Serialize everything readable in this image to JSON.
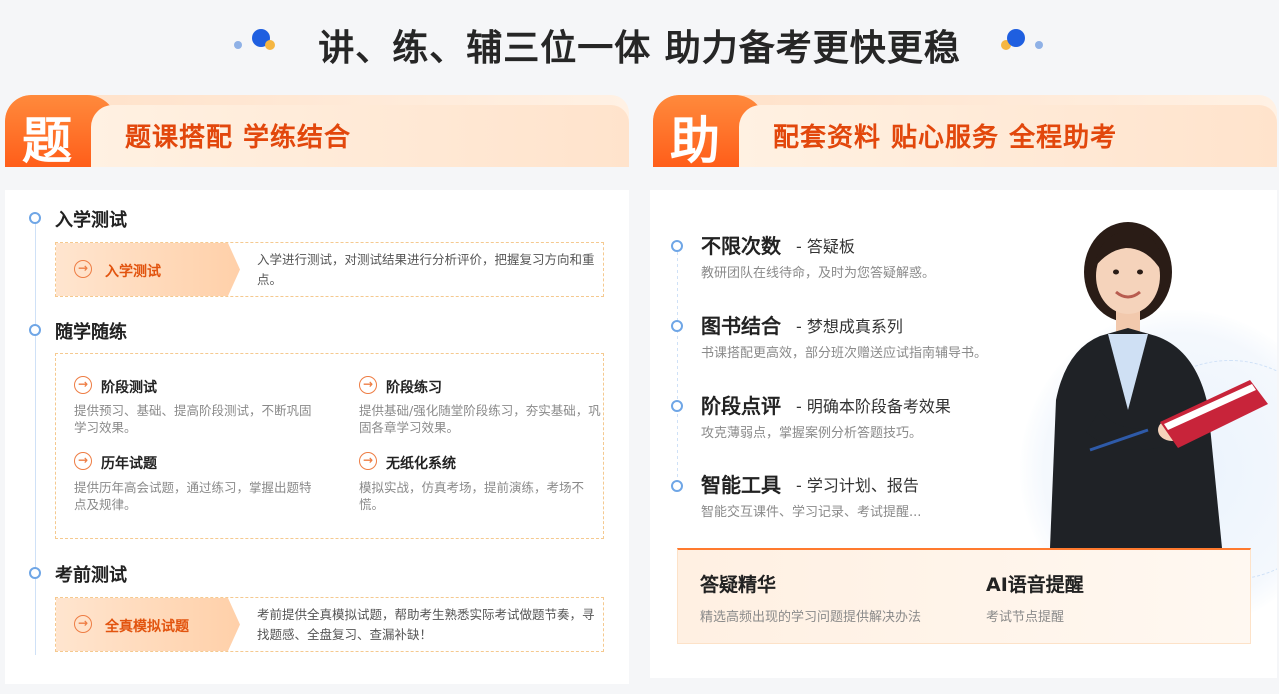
{
  "header": {
    "title": "讲、练、辅三位一体 助力备考更快更稳"
  },
  "colors": {
    "accent": "#ff6a22",
    "title_orange": "#e2470c",
    "node_blue": "#6fa6e6",
    "dot_blue": "#1f5fe0",
    "dot_yellow": "#f5b642"
  },
  "left_panel": {
    "badge": "题",
    "banner_title": "题课搭配 学练结合",
    "sections": [
      {
        "title": "入学测试",
        "tag": "入学测试",
        "desc": "入学进行测试，对测试结果进行分析评价，把握复习方向和重点。"
      },
      {
        "title": "随学随练",
        "items": [
          {
            "title": "阶段测试",
            "desc": "提供预习、基础、提高阶段测试，不断巩固学习效果。"
          },
          {
            "title": "阶段练习",
            "desc": "提供基础/强化随堂阶段练习，夯实基础，巩固各章学习效果。"
          },
          {
            "title": "历年试题",
            "desc": "提供历年高会试题，通过练习，掌握出题特点及规律。"
          },
          {
            "title": "无纸化系统",
            "desc": "模拟实战，仿真考场，提前演练，考场不慌。"
          }
        ]
      },
      {
        "title": "考前测试",
        "tag": "全真模拟试题",
        "desc": "考前提供全真模拟试题，帮助考生熟悉实际考试做题节奏，寻找题感、全盘复习、查漏补缺！"
      }
    ]
  },
  "right_panel": {
    "badge": "助",
    "banner_title": "配套资料 贴心服务 全程助考",
    "items": [
      {
        "title": "不限次数",
        "sub": "- 答疑板",
        "desc": "教研团队在线待命，及时为您答疑解惑。"
      },
      {
        "title": "图书结合",
        "sub": "- 梦想成真系列",
        "desc": "书课搭配更高效，部分班次赠送应试指南辅导书。"
      },
      {
        "title": "阶段点评",
        "sub": "- 明确本阶段备考效果",
        "desc": "攻克薄弱点，掌握案例分析答题技巧。"
      },
      {
        "title": "智能工具",
        "sub": "- 学习计划、报告",
        "desc": "智能交互课件、学习记录、考试提醒..."
      }
    ],
    "bottom": [
      {
        "title": "答疑精华",
        "desc": "精选高频出现的学习问题提供解决办法"
      },
      {
        "title": "AI语音提醒",
        "desc": "考试节点提醒"
      }
    ]
  }
}
